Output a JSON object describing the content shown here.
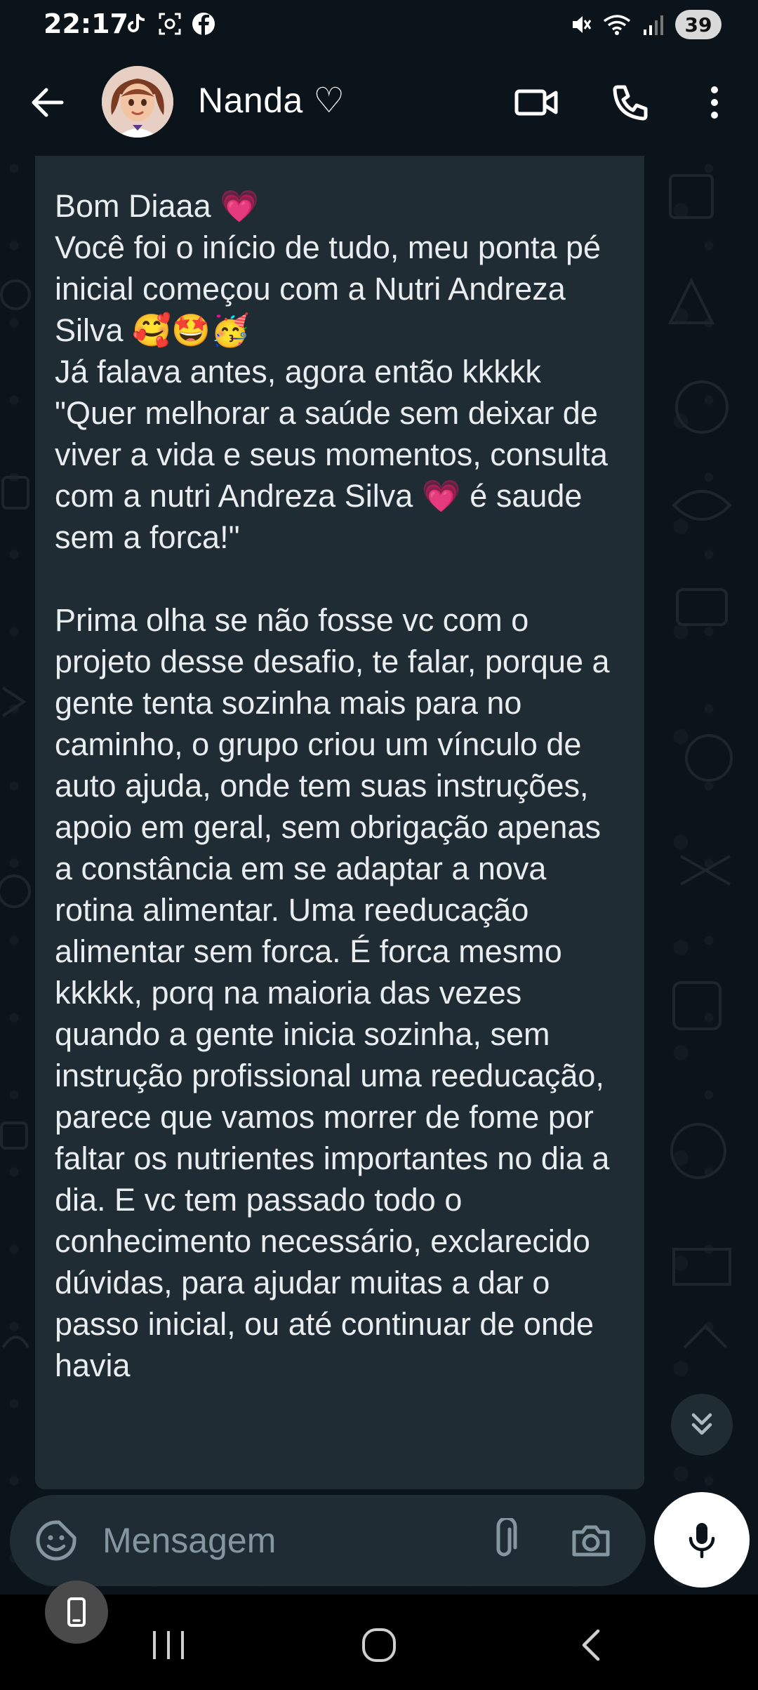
{
  "status_bar": {
    "time": "22:17",
    "left_icons": [
      "tiktok-icon",
      "screenshot-icon",
      "facebook-icon"
    ],
    "right_icons": [
      "mute-icon",
      "wifi-icon",
      "signal-icon"
    ],
    "battery": "39"
  },
  "header": {
    "contact_name": "Nanda ♡",
    "actions": [
      "back-arrow-icon",
      "video-call-icon",
      "voice-call-icon",
      "more-options-icon"
    ]
  },
  "message": {
    "text": "Bom Diaaa 💗\nVocê foi o início de tudo, meu ponta pé inicial começou com a Nutri Andreza Silva 🥰🤩🥳\nJá falava antes, agora então kkkkk \"Quer melhorar a saúde sem deixar de viver a vida e seus momentos, consulta  com a nutri Andreza Silva 💗 é saude sem a forca!\"\n\nPrima olha se não fosse vc com o projeto desse desafio, te falar, porque a gente tenta sozinha mais para no caminho, o grupo criou um vínculo de auto ajuda, onde tem suas instruções, apoio em geral, sem obrigação apenas a constância em se adaptar a nova rotina alimentar. Uma reeducação alimentar sem forca. É forca mesmo kkkkk, porq na maioria das vezes quando a gente inicia sozinha, sem instrução profissional uma reeducação, parece que vamos morrer de fome por faltar os nutrientes importantes no dia a dia. E vc tem passado todo o conhecimento necessário, exclarecido dúvidas, para ajudar muitas a dar o passo inicial, ou até continuar de onde havia"
  },
  "composer": {
    "placeholder": "Mensagem"
  },
  "colors": {
    "background": "#0b141a",
    "bubble": "#202c33",
    "composer": "#1f2c34",
    "text": "#e9edef",
    "placeholder": "#8696a0"
  }
}
